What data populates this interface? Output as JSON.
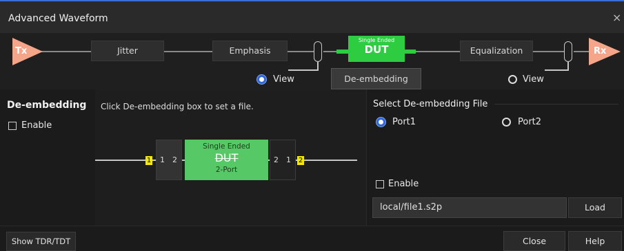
{
  "window": {
    "title": "Advanced Waveform",
    "close_glyph": "×"
  },
  "pipeline": {
    "tx_label": "Tx",
    "rx_label": "Rx",
    "jitter_label": "Jitter",
    "emphasis_label": "Emphasis",
    "dut_small_label": "Single Ended",
    "dut_label": "DUT",
    "equalization_label": "Equalization",
    "deembedding_button_label": "De-embedding",
    "view_left_label": "View",
    "view_right_label": "View"
  },
  "left_panel": {
    "title": "De-embedding",
    "enable_label": "Enable"
  },
  "mid_panel": {
    "hint": "Click De-embedding box to set a file.",
    "left_port_yellow": "1",
    "left_ports": [
      "1",
      "2"
    ],
    "dut_top": "Single Ended",
    "dut_main": "DUT",
    "dut_bottom": "2-Port",
    "right_ports": [
      "2",
      "1"
    ],
    "right_port_yellow": "2"
  },
  "right_panel": {
    "title": "Select De-embedding File",
    "port1_label": "Port1",
    "port2_label": "Port2",
    "enable_label": "Enable",
    "file_value": "local/file1.s2p",
    "load_label": "Load"
  },
  "bottom": {
    "show_tdr_label": "Show TDR/TDT",
    "close_label": "Close",
    "help_label": "Help"
  },
  "colors": {
    "accent_blue": "#2f67d8",
    "dut_green": "#2ecc40",
    "tx_rx_orange": "#f4a58a",
    "port_yellow": "#f5e800"
  }
}
